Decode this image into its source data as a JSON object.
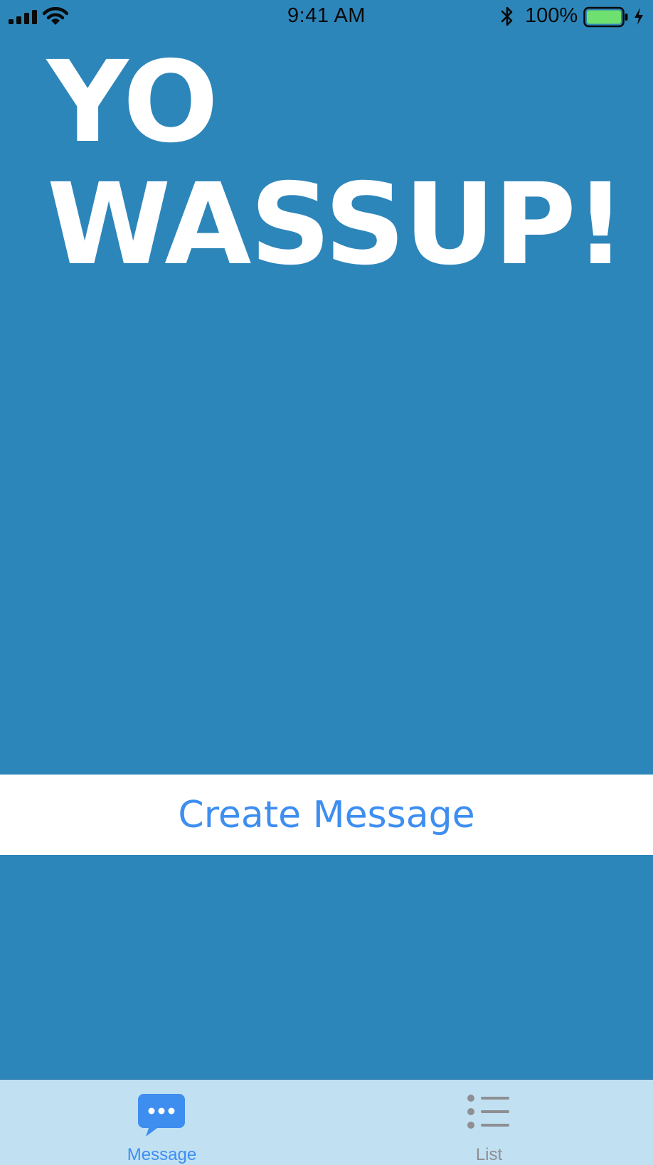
{
  "status_bar": {
    "time": "9:41 AM",
    "battery_percent": "100%",
    "battery_level": 1.0,
    "icons": [
      "signal-icon",
      "wifi-icon",
      "bluetooth-icon",
      "battery-icon",
      "charging-icon"
    ]
  },
  "main": {
    "headline": "YO WASSUP!",
    "create_button_label": "Create Message"
  },
  "tab_bar": {
    "tabs": [
      {
        "label": "Message",
        "icon": "message-bubble-icon",
        "selected": true
      },
      {
        "label": "List",
        "icon": "list-icon",
        "selected": false
      }
    ]
  },
  "colors": {
    "background": "#2d86ba",
    "accent": "#3e8ef0",
    "tab_bar_background": "#c1e1f3",
    "inactive_tab": "#8e8e93",
    "battery_fill": "#6ee06f"
  }
}
